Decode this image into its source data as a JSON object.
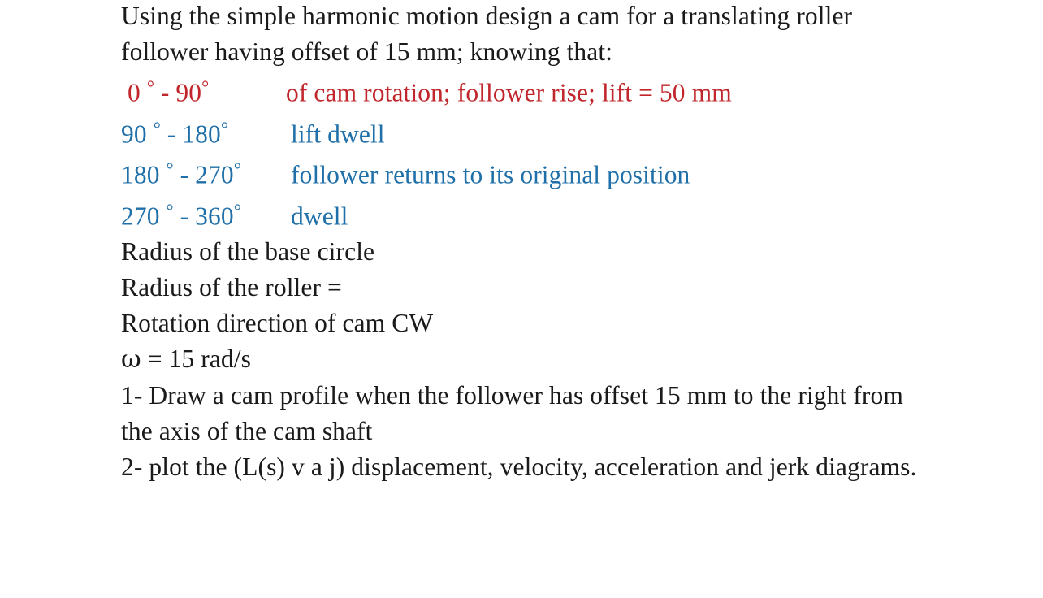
{
  "slide": {
    "background_color": "#ffffff",
    "body_text_color": "#1a1a1a",
    "highlight_red": "#c0262b",
    "highlight_blue": "#1f6fa8"
  },
  "content": {
    "intro": "Using the simple harmonic motion design a cam for a translating roller follower having offset of 15 mm; knowing that:",
    "motion_schedule": [
      {
        "range_start": " 0 ",
        "range_mid": " - 90",
        "description": "of cam rotation; follower rise; lift = 50 mm",
        "color": "red"
      },
      {
        "range_start": "90 ",
        "range_mid": " - 180",
        "description": "lift dwell",
        "color": "blue"
      },
      {
        "range_start": "180 ",
        "range_mid": " - 270",
        "description": "follower returns to its original position",
        "color": "blue"
      },
      {
        "range_start": "270 ",
        "range_mid": " - 360",
        "description": "dwell",
        "color": "blue"
      }
    ],
    "degree_symbol": "°",
    "parameters": [
      "Radius of the base circle",
      "Radius of the roller =",
      "Rotation direction of cam CW"
    ],
    "omega_symbol": "ω",
    "omega_value": " = 15 rad/s",
    "tasks": [
      "1- Draw a cam profile when the follower has offset 15 mm to the right from the axis of the cam shaft",
      "2- plot the (L(s) v a j) displacement, velocity, acceleration and jerk diagrams."
    ]
  }
}
